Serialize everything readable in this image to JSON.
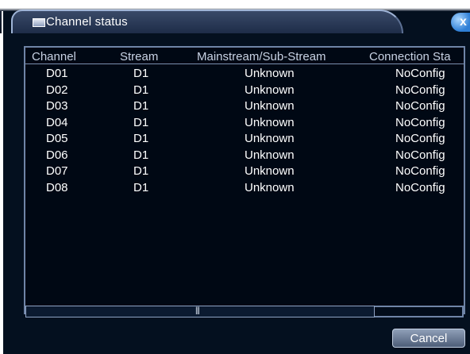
{
  "window": {
    "title": "Channel status",
    "close_glyph": "x"
  },
  "table": {
    "columns": [
      "Channel",
      "Stream",
      "Mainstream/Sub-Stream",
      "Connection Sta"
    ],
    "rows": [
      [
        "D01",
        "D1",
        "Unknown",
        "NoConfig"
      ],
      [
        "D02",
        "D1",
        "Unknown",
        "NoConfig"
      ],
      [
        "D03",
        "D1",
        "Unknown",
        "NoConfig"
      ],
      [
        "D04",
        "D1",
        "Unknown",
        "NoConfig"
      ],
      [
        "D05",
        "D1",
        "Unknown",
        "NoConfig"
      ],
      [
        "D06",
        "D1",
        "Unknown",
        "NoConfig"
      ],
      [
        "D07",
        "D1",
        "Unknown",
        "NoConfig"
      ],
      [
        "D08",
        "D1",
        "Unknown",
        "NoConfig"
      ]
    ]
  },
  "scrollbar": {
    "thumb_glyph": "|||"
  },
  "buttons": {
    "cancel_label": "Cancel"
  }
}
